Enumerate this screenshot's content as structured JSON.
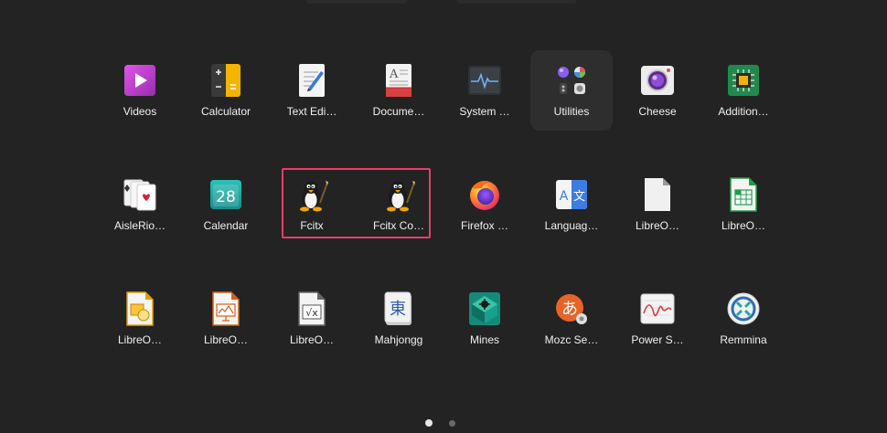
{
  "apps": [
    {
      "id": "videos",
      "label": "Videos",
      "icon": "videos-icon"
    },
    {
      "id": "calculator",
      "label": "Calculator",
      "icon": "calculator-icon"
    },
    {
      "id": "text-editor",
      "label": "Text Edi…",
      "icon": "text-editor-icon"
    },
    {
      "id": "document-viewer",
      "label": "Docume…",
      "icon": "document-viewer-icon"
    },
    {
      "id": "system-monitor",
      "label": "System …",
      "icon": "system-monitor-icon"
    },
    {
      "id": "utilities",
      "label": "Utilities",
      "icon": "utilities-folder-icon",
      "selected": true
    },
    {
      "id": "cheese",
      "label": "Cheese",
      "icon": "cheese-icon"
    },
    {
      "id": "additional-drivers",
      "label": "Addition…",
      "icon": "additional-drivers-icon"
    },
    {
      "id": "aisleriot",
      "label": "AisleRio…",
      "icon": "aisleriot-icon"
    },
    {
      "id": "calendar",
      "label": "Calendar",
      "icon": "calendar-icon",
      "text": "28"
    },
    {
      "id": "fcitx",
      "label": "Fcitx",
      "icon": "fcitx-penguin-icon"
    },
    {
      "id": "fcitx-config",
      "label": "Fcitx Co…",
      "icon": "fcitx-config-penguin-icon"
    },
    {
      "id": "firefox",
      "label": "Firefox …",
      "icon": "firefox-icon"
    },
    {
      "id": "language-support",
      "label": "Languag…",
      "icon": "language-support-icon",
      "text": "A",
      "text2": "文"
    },
    {
      "id": "libreoffice",
      "label": "LibreO…",
      "icon": "libreoffice-icon"
    },
    {
      "id": "libreoffice-calc",
      "label": "LibreO…",
      "icon": "libreoffice-calc-icon"
    },
    {
      "id": "libreoffice-draw",
      "label": "LibreO…",
      "icon": "libreoffice-draw-icon"
    },
    {
      "id": "libreoffice-impress",
      "label": "LibreO…",
      "icon": "libreoffice-impress-icon"
    },
    {
      "id": "libreoffice-math",
      "label": "LibreO…",
      "icon": "libreoffice-math-icon",
      "text": "√x"
    },
    {
      "id": "mahjongg",
      "label": "Mahjongg",
      "icon": "mahjongg-icon",
      "text": "東"
    },
    {
      "id": "mines",
      "label": "Mines",
      "icon": "mines-icon"
    },
    {
      "id": "mozc-setup",
      "label": "Mozc Se…",
      "icon": "mozc-icon",
      "text": "あ"
    },
    {
      "id": "power-statistics",
      "label": "Power S…",
      "icon": "power-statistics-icon"
    },
    {
      "id": "remmina",
      "label": "Remmina",
      "icon": "remmina-icon"
    }
  ],
  "pagination": {
    "pages": 2,
    "current": 1
  }
}
